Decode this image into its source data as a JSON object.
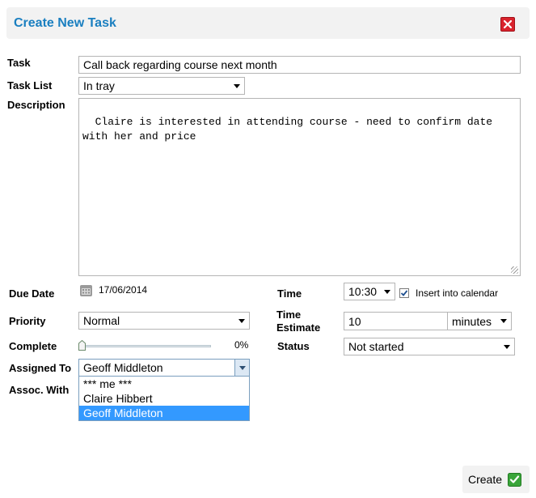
{
  "dialog": {
    "title": "Create New Task"
  },
  "form": {
    "task": {
      "label": "Task",
      "value": "Call back regarding course next month"
    },
    "task_list": {
      "label": "Task List",
      "value": "In tray"
    },
    "description": {
      "label": "Description",
      "value": "Claire is interested in attending course - need to confirm date\nwith her and price"
    },
    "due_date": {
      "label": "Due Date",
      "value": "17/06/2014"
    },
    "priority": {
      "label": "Priority",
      "value": "Normal"
    },
    "complete": {
      "label": "Complete",
      "value_text": "0%",
      "value": 0
    },
    "assigned_to": {
      "label": "Assigned To",
      "value": "Geoff Middleton",
      "options": [
        "*** me ***",
        "Claire Hibbert",
        "Geoff Middleton"
      ],
      "selected_index": 2
    },
    "assoc_with": {
      "label": "Assoc. With"
    },
    "time": {
      "label": "Time",
      "value": "10:30",
      "insert_calendar_label": "Insert into calendar",
      "insert_calendar_checked": true
    },
    "time_estimate": {
      "label_line1": "Time",
      "label_line2": "Estimate",
      "value": "10",
      "unit": "minutes"
    },
    "status": {
      "label": "Status",
      "value": "Not started"
    }
  },
  "footer": {
    "create_label": "Create"
  },
  "colors": {
    "title": "#1a7fc0",
    "close": "#d9232d",
    "selection": "#3399ff",
    "create_icon": "#3aa53a"
  },
  "icons": {
    "close": "close-icon",
    "calendar": "calendar-icon",
    "create": "checkmark-icon",
    "slider": "slider-thumb-icon"
  }
}
